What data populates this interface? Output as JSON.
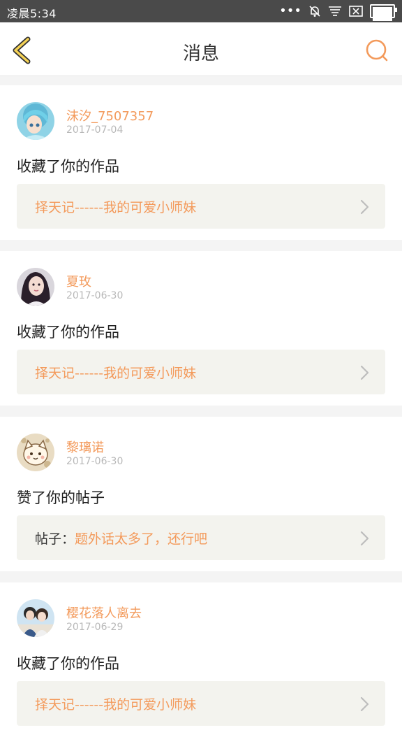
{
  "status_bar": {
    "time": "凌晨5:34",
    "icons": [
      "more-dots-icon",
      "bell-off-icon",
      "notification-lines-icon",
      "close-box-icon",
      "battery-icon"
    ]
  },
  "header": {
    "title": "消息",
    "back_icon": "chevron-left-icon",
    "search_icon": "search-icon",
    "accent_color": "#f39a5b"
  },
  "messages": [
    {
      "user": "沫汐_7507357",
      "date": "2017-07-04",
      "action": "收藏了你的作品",
      "ref_prefix": "",
      "ref_title": "择天记------我的可爱小师妹",
      "avatar": "anime-girl-avatar"
    },
    {
      "user": "夏玫",
      "date": "2017-06-30",
      "action": "收藏了你的作品",
      "ref_prefix": "",
      "ref_title": "择天记------我的可爱小师妹",
      "avatar": "portrait-avatar"
    },
    {
      "user": "黎璃诺",
      "date": "2017-06-30",
      "action": "赞了你的帖子",
      "ref_prefix": "帖子：",
      "ref_title": "题外话太多了，还行吧",
      "avatar": "cartoon-cat-avatar"
    },
    {
      "user": "樱花落人离去",
      "date": "2017-06-29",
      "action": "收藏了你的作品",
      "ref_prefix": "",
      "ref_title": "择天记------我的可爱小师妹",
      "avatar": "couple-avatar"
    }
  ]
}
